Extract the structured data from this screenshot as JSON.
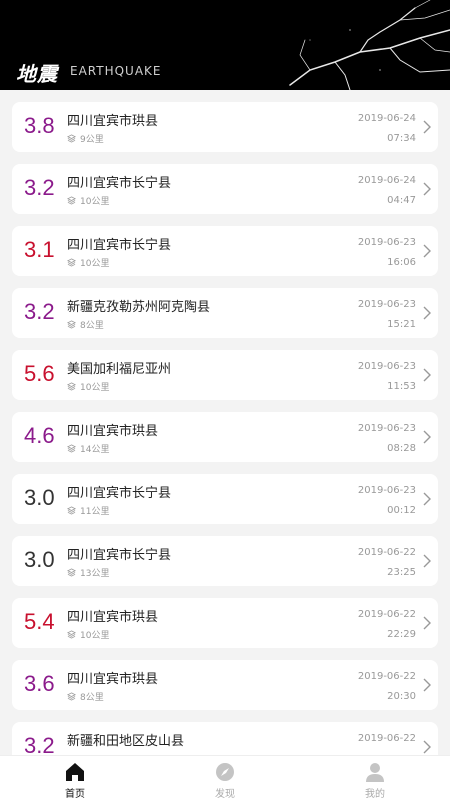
{
  "header": {
    "logo": "地震",
    "subtitle": "EARTHQUAKE"
  },
  "colors": {
    "red": "#c8102e",
    "purple": "#8b1a8b",
    "black": "#333333"
  },
  "quakes": [
    {
      "mag": "3.8",
      "place": "四川宜宾市珙县",
      "depth": "9公里",
      "date": "2019-06-24",
      "time": "07:34",
      "color": "purple"
    },
    {
      "mag": "3.2",
      "place": "四川宜宾市长宁县",
      "depth": "10公里",
      "date": "2019-06-24",
      "time": "04:47",
      "color": "purple"
    },
    {
      "mag": "3.1",
      "place": "四川宜宾市长宁县",
      "depth": "10公里",
      "date": "2019-06-23",
      "time": "16:06",
      "color": "red"
    },
    {
      "mag": "3.2",
      "place": "新疆克孜勒苏州阿克陶县",
      "depth": "8公里",
      "date": "2019-06-23",
      "time": "15:21",
      "color": "purple"
    },
    {
      "mag": "5.6",
      "place": "美国加利福尼亚州",
      "depth": "10公里",
      "date": "2019-06-23",
      "time": "11:53",
      "color": "red"
    },
    {
      "mag": "4.6",
      "place": "四川宜宾市珙县",
      "depth": "14公里",
      "date": "2019-06-23",
      "time": "08:28",
      "color": "purple"
    },
    {
      "mag": "3.0",
      "place": "四川宜宾市长宁县",
      "depth": "11公里",
      "date": "2019-06-23",
      "time": "00:12",
      "color": "black"
    },
    {
      "mag": "3.0",
      "place": "四川宜宾市长宁县",
      "depth": "13公里",
      "date": "2019-06-22",
      "time": "23:25",
      "color": "black"
    },
    {
      "mag": "5.4",
      "place": "四川宜宾市珙县",
      "depth": "10公里",
      "date": "2019-06-22",
      "time": "22:29",
      "color": "red"
    },
    {
      "mag": "3.6",
      "place": "四川宜宾市珙县",
      "depth": "8公里",
      "date": "2019-06-22",
      "time": "20:30",
      "color": "purple"
    },
    {
      "mag": "3.2",
      "place": "新疆和田地区皮山县",
      "depth": "",
      "date": "2019-06-22",
      "time": "",
      "color": "purple"
    }
  ],
  "tabs": [
    {
      "label": "首页",
      "icon": "home-icon",
      "active": true
    },
    {
      "label": "发现",
      "icon": "compass-icon",
      "active": false
    },
    {
      "label": "我的",
      "icon": "person-icon",
      "active": false
    }
  ]
}
